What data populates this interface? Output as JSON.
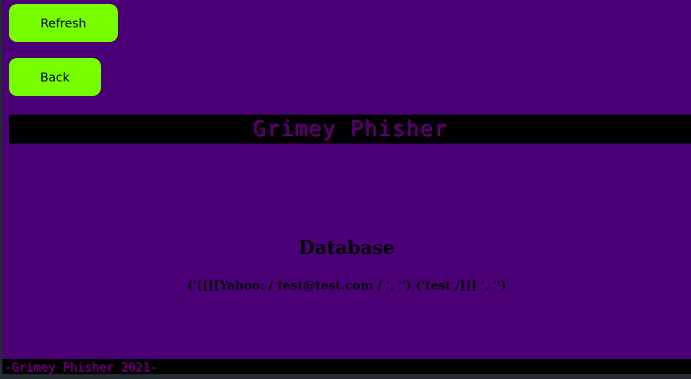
{
  "buttons": {
    "refresh": "Refresh",
    "back": "Back"
  },
  "banner": {
    "title": "Grimey Phisher"
  },
  "main": {
    "heading": "Database",
    "record": "('[[[[Yahoo: / test@test.com / ', '') ('test /]]] ', '')"
  },
  "footer": {
    "text": "-Grimey Phisher 2021-"
  },
  "colors": {
    "background": "#4b0077",
    "button": "#77ff00",
    "bar": "#000000"
  }
}
